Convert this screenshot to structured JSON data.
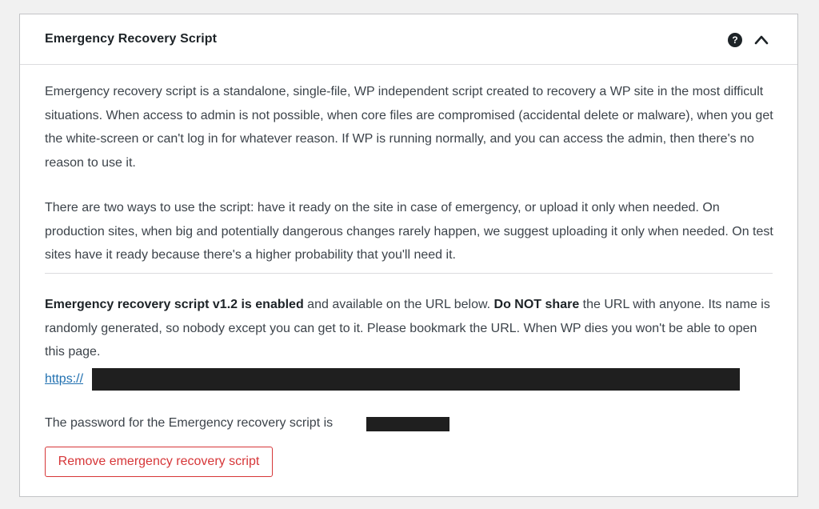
{
  "panel": {
    "title": "Emergency Recovery Script",
    "help_icon_glyph": "?",
    "icons": [
      "help-icon",
      "chevron-up-icon"
    ]
  },
  "intro": {
    "paragraph1": "Emergency recovery script is a standalone, single-file, WP independent script created to recovery a WP site in the most difficult situations. When access to admin is not possible, when core files are compromised (accidental delete or malware), when you get the white-screen or can't log in for whatever reason. If WP is running normally, and you can access the admin, then there's no reason to use it.",
    "paragraph2": "There are two ways to use the script: have it ready on the site in case of emergency, or upload it only when needed. On production sites, when big and potentially dangerous changes rarely happen, we suggest uploading it only when needed. On test sites have it ready because there's a higher probability that you'll need it."
  },
  "status": {
    "enabled_strong": "Emergency recovery script v1.2 is enabled",
    "enabled_rest": " and available on the URL below. ",
    "warning_strong": "Do NOT share",
    "warning_rest": " the URL with anyone. Its name is randomly generated, so nobody except you can get to it. Please bookmark the URL. When WP dies you won't be able to open this page.",
    "url_prefix": "https://",
    "password_text": "The password for the Emergency recovery script is"
  },
  "actions": {
    "remove_label": "Remove emergency recovery script"
  },
  "colors": {
    "link": "#2271b1",
    "danger": "#d63638",
    "redaction": "#1f1f1f"
  }
}
